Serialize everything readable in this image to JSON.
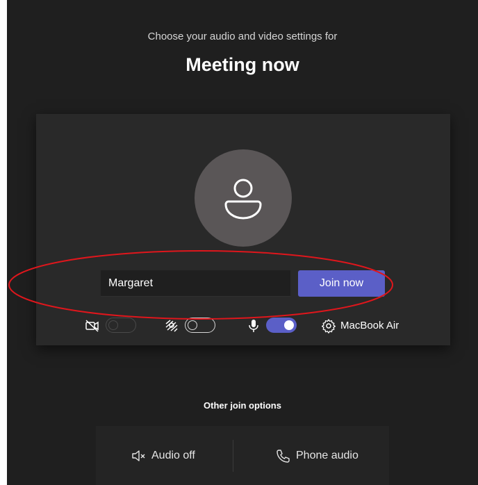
{
  "header": {
    "subtitle": "Choose your audio and video settings for",
    "meeting_title": "Meeting now"
  },
  "prejoin": {
    "name_value": "Margaret",
    "join_label": "Join now",
    "camera": {
      "icon": "camera-off-icon",
      "enabled": false
    },
    "background_effects": {
      "icon": "background-blur-icon",
      "enabled": false
    },
    "microphone": {
      "icon": "microphone-icon",
      "enabled": true
    },
    "device": {
      "icon": "gear-icon",
      "label": "MacBook Air"
    }
  },
  "other_options": {
    "heading": "Other join options",
    "items": [
      {
        "icon": "speaker-off-icon",
        "label": "Audio off"
      },
      {
        "icon": "phone-icon",
        "label": "Phone audio"
      }
    ]
  },
  "colors": {
    "background": "#1f1f1f",
    "card": "#292929",
    "accent": "#5b5fc7",
    "annotation": "#e0161c"
  }
}
